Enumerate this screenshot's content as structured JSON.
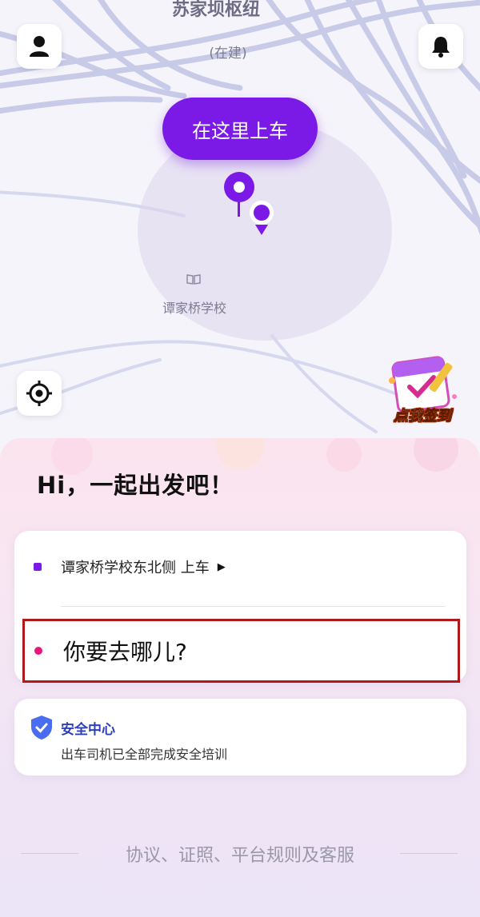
{
  "map": {
    "title": "苏家坝枢纽",
    "subtitle": "(在建)",
    "pickup_label": "在这里上车",
    "school_label": "谭家桥学校"
  },
  "header": {
    "profile_icon": "person-icon",
    "bell_icon": "bell-icon"
  },
  "locate_icon": "locate-target-icon",
  "signin_badge": {
    "label": "点我签到"
  },
  "sheet": {
    "greeting": "Hi，一起出发吧！",
    "route": {
      "from_label": "谭家桥学校东北侧 上车",
      "from_arrow": "▶",
      "to_placeholder": "你要去哪儿?"
    },
    "safety": {
      "title": "安全中心",
      "description": "出车司机已全部完成安全培训"
    },
    "footer": "协议、证照、平台规则及客服"
  },
  "colors": {
    "accent": "#7b19e6",
    "destination_dot": "#e8157a",
    "highlight_border": "#b0191b",
    "safety_blue": "#2f3fb6"
  }
}
